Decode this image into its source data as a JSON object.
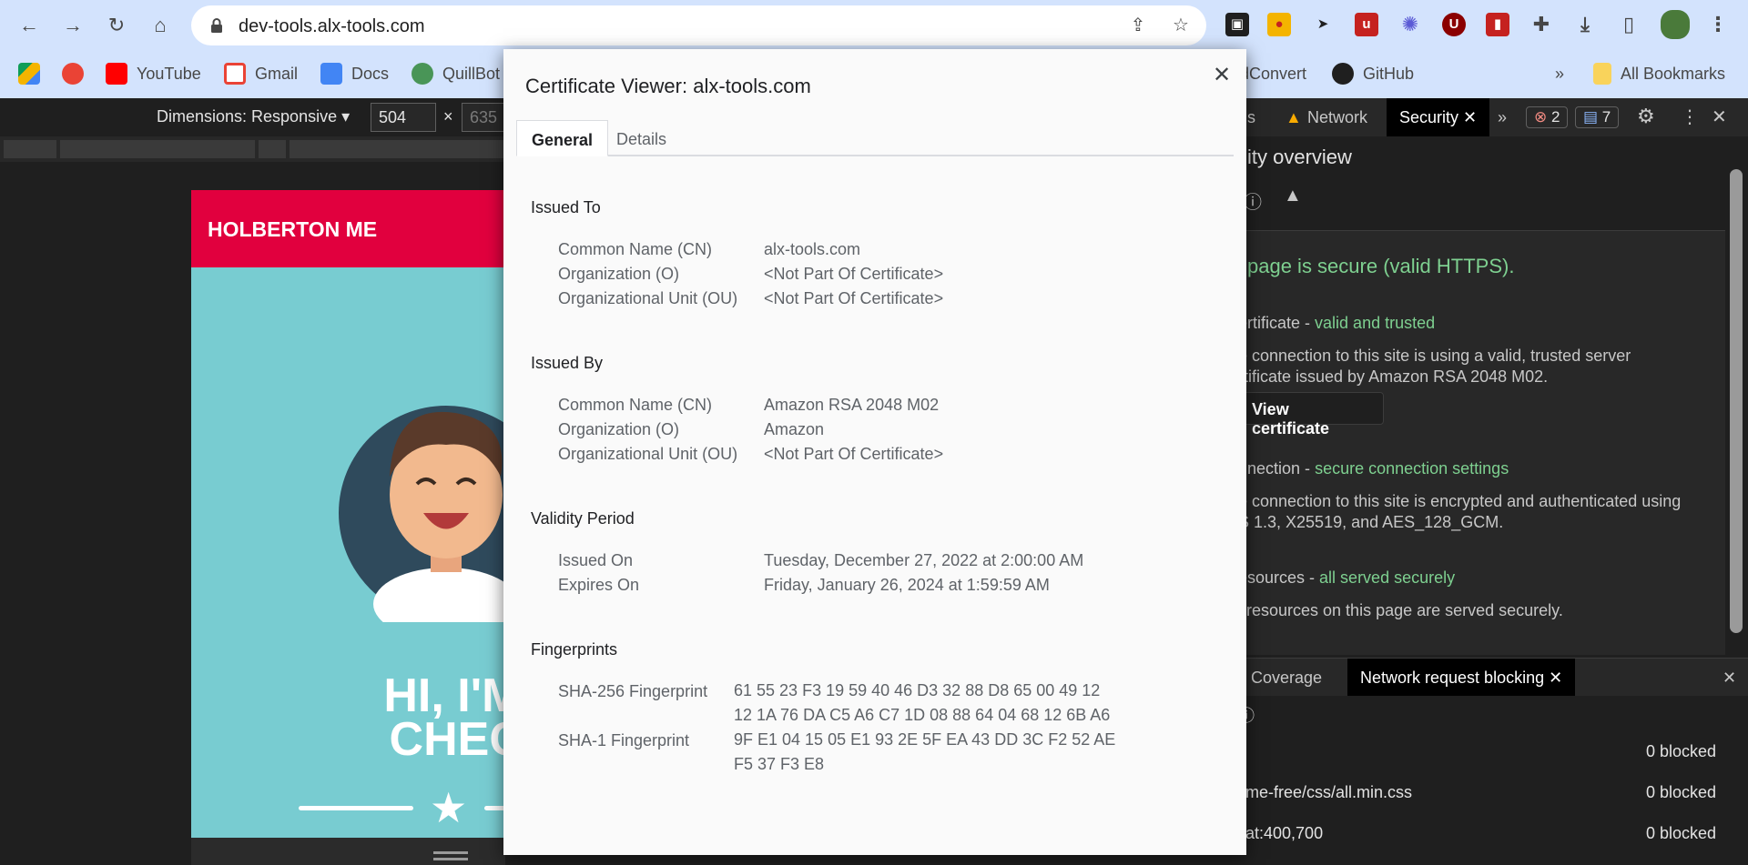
{
  "browser": {
    "url": "dev-tools.alx-tools.com",
    "bookmarks": [
      "YouTube",
      "Gmail",
      "Docs",
      "QuillBot",
      "dConvert",
      "GitHub"
    ],
    "more_label": "»",
    "all_bookmarks": "All Bookmarks"
  },
  "device_toolbar": {
    "dimensions_label": "Dimensions: Responsive ▾",
    "width": "504",
    "times": "×",
    "height": "635"
  },
  "emulated_page": {
    "brand": "HOLBERTON ME",
    "hero_line1": "HI, I'M T",
    "hero_line2": "CHECK"
  },
  "devtools": {
    "tabs": {
      "prev": "s",
      "network": "Network",
      "security": "Security",
      "more": "»"
    },
    "errors": "2",
    "messages": "7",
    "overview_title": "ity overview",
    "secure_heading": "page is secure (valid HTTPS).",
    "certificate_label": "ertificate - ",
    "certificate_status": "valid and trusted",
    "certificate_desc1": "e connection to this site is using a valid, trusted server",
    "certificate_desc2": "rtificate issued by Amazon RSA 2048 M02.",
    "view_certificate": "View certificate",
    "connection_label": "nnection - ",
    "connection_status": "secure connection settings",
    "connection_desc1": "e connection to this site is encrypted and authenticated using",
    "connection_desc2": "S 1.3, X25519, and AES_128_GCM.",
    "resources_label": "esources - ",
    "resources_status": "all served securely",
    "resources_desc": "l resources on this page are served securely.",
    "drawer_tabs": {
      "coverage": "Coverage",
      "blocking": "Network request blocking"
    },
    "blocked_rows": [
      {
        "pattern": "",
        "count": "0 blocked"
      },
      {
        "pattern": "me-free/css/all.min.css",
        "count": "0 blocked"
      },
      {
        "pattern": "at:400,700",
        "count": "0 blocked"
      }
    ]
  },
  "dialog": {
    "title": "Certificate Viewer: alx-tools.com",
    "tabs": [
      "General",
      "Details"
    ],
    "issued_to": {
      "title": "Issued To",
      "rows": [
        {
          "label": "Common Name (CN)",
          "value": "alx-tools.com"
        },
        {
          "label": "Organization (O)",
          "value": "<Not Part Of Certificate>"
        },
        {
          "label": "Organizational Unit (OU)",
          "value": "<Not Part Of Certificate>"
        }
      ]
    },
    "issued_by": {
      "title": "Issued By",
      "rows": [
        {
          "label": "Common Name (CN)",
          "value": "Amazon RSA 2048 M02"
        },
        {
          "label": "Organization (O)",
          "value": "Amazon"
        },
        {
          "label": "Organizational Unit (OU)",
          "value": "<Not Part Of Certificate>"
        }
      ]
    },
    "validity": {
      "title": "Validity Period",
      "rows": [
        {
          "label": "Issued On",
          "value": "Tuesday, December 27, 2022 at 2:00:00 AM"
        },
        {
          "label": "Expires On",
          "value": "Friday, January 26, 2024 at 1:59:59 AM"
        }
      ]
    },
    "fingerprints": {
      "title": "Fingerprints",
      "sha256_label": "SHA-256 Fingerprint",
      "sha256": "61 55 23 F3 19 59 40 46 D3 32 88 D8 65 00 49 12 12 1A 76 DA C5 A6 C7 1D 08 88 64 04 68 12 6B A6",
      "sha1_label": "SHA-1 Fingerprint",
      "sha1": "9F E1 04 15 05 E1 93 2E 5F EA 43 DD 3C F2 52 AE F5 37 F3 E8"
    }
  }
}
